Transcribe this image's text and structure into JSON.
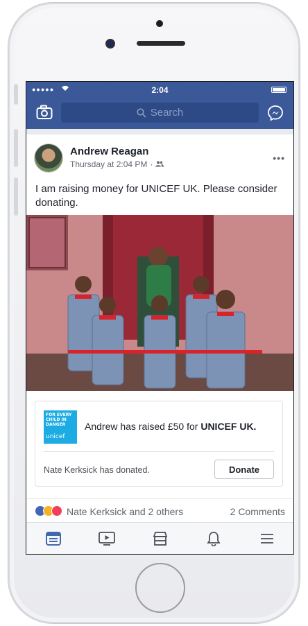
{
  "status_bar": {
    "signal": "●●●●●",
    "time": "2:04",
    "battery_level": 1.0
  },
  "header": {
    "search_placeholder": "Search"
  },
  "post": {
    "author": "Andrew Reagan",
    "timestamp": "Thursday at 2:04 PM",
    "separator": "·",
    "message": "I am raising money for UNICEF UK. Please consider donating.",
    "fundraiser": {
      "logo_text": [
        "FOR EVERY",
        "CHILD IN",
        "DANGER"
      ],
      "logo_brand": "unicef",
      "raised_prefix": "Andrew has raised £50 for ",
      "raised_org": "UNICEF UK.",
      "donated_text": "Nate Kerksick has donated.",
      "donate_label": "Donate"
    },
    "reactions": {
      "names": "Nate Kerksick and 2 others",
      "comments": "2 Comments",
      "types": [
        "like-icon",
        "wow-icon",
        "love-icon"
      ]
    }
  },
  "tabs": [
    "news-feed-icon",
    "video-icon",
    "marketplace-icon",
    "notifications-icon",
    "menu-icon"
  ],
  "colors": {
    "brand": "#3b5998",
    "active_tab": "#4267b2",
    "inactive_tab": "#4b4f56"
  }
}
